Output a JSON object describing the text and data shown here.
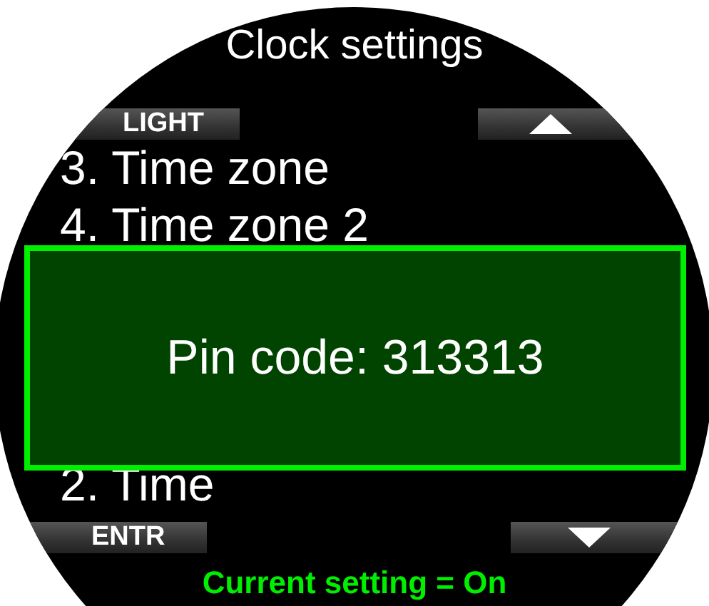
{
  "title": "Clock settings",
  "top_keys": {
    "left": "LIGHT"
  },
  "bottom_keys": {
    "left": "ENTR"
  },
  "menu_items": [
    {
      "label": "3. Time zone"
    },
    {
      "label": "4. Time zone 2"
    },
    {
      "label": "2. Time"
    }
  ],
  "dialog": {
    "message": "Pin code: 313313"
  },
  "status": "Current setting = On"
}
